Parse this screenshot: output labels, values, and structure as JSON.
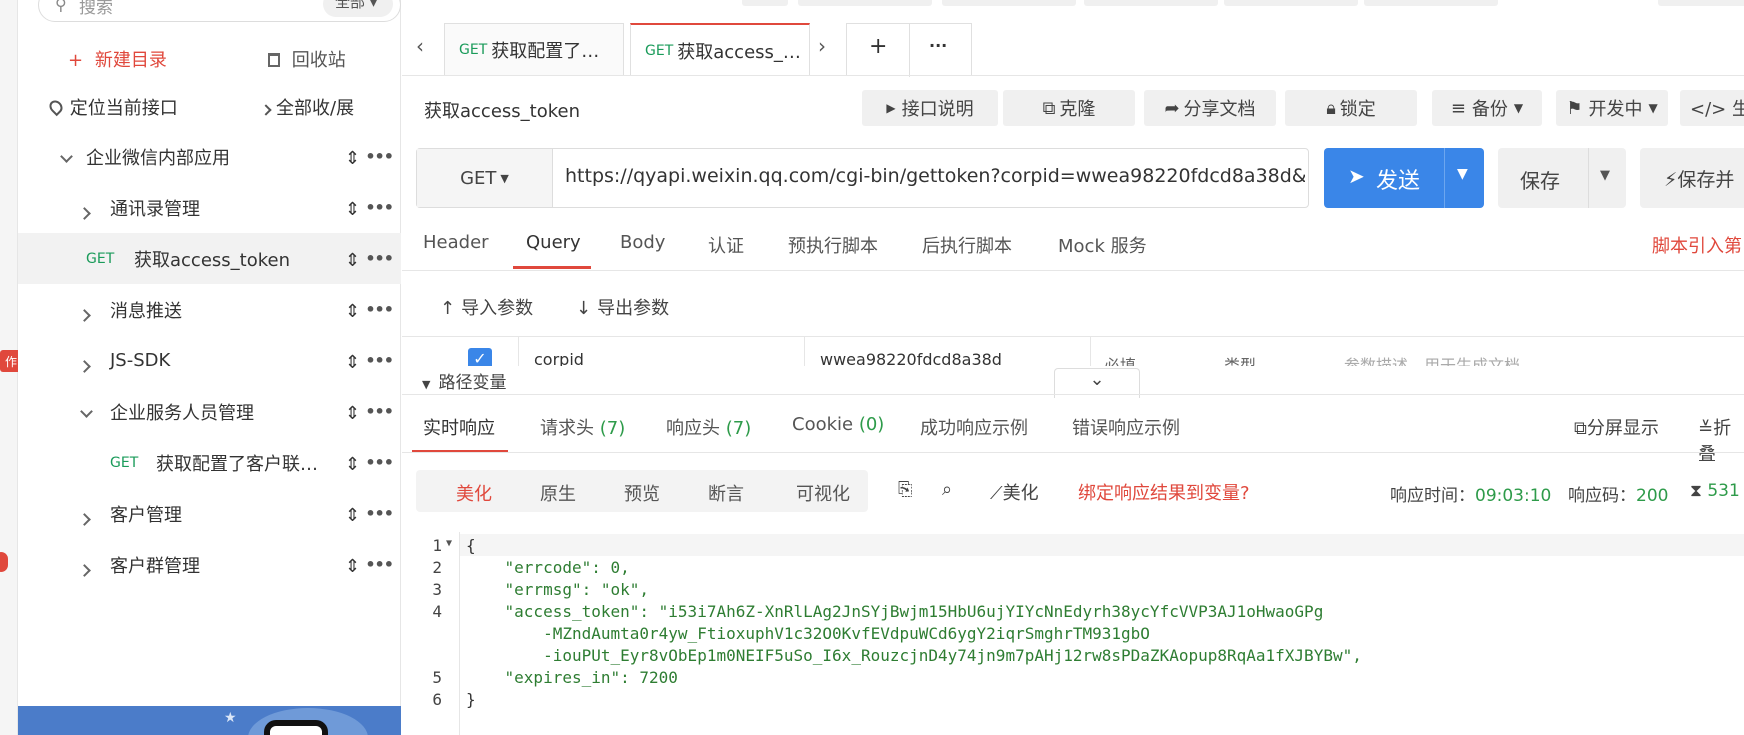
{
  "sidebar": {
    "search_placeholder": "搜索",
    "filter_label": "全部",
    "new_folder": "新建目录",
    "recycle": "回收站",
    "locate": "定位当前接口",
    "expand_all": "全部收/展",
    "tree": [
      {
        "label": "企业微信内部应用"
      },
      {
        "label": "通讯录管理"
      },
      {
        "method": "GET",
        "label": "获取access_token"
      },
      {
        "label": "消息推送"
      },
      {
        "label": "JS-SDK"
      },
      {
        "label": "企业服务人员管理"
      },
      {
        "method": "GET",
        "label": "获取配置了客户联…"
      },
      {
        "label": "客户管理"
      },
      {
        "label": "客户群管理"
      }
    ],
    "edge_badge": "作"
  },
  "tabs": [
    {
      "method": "GET",
      "label": "获取配置了…"
    },
    {
      "method": "GET",
      "label": "获取access_…"
    }
  ],
  "tabs_add": "+",
  "tabs_more": "···",
  "request": {
    "title": "获取access_token",
    "actions": [
      "接口说明",
      "克隆",
      "分享文档",
      "锁定",
      "备份",
      "开发中",
      "</> 生"
    ],
    "method": "GET",
    "url": "https://qyapi.weixin.qq.com/cgi-bin/gettoken?corpid=wwea98220fdcd8a38d&",
    "send": "发送",
    "save": "保存",
    "save_run": "保存并"
  },
  "param_tabs": [
    "Header",
    "Query",
    "Body",
    "认证",
    "预执行脚本",
    "后执行脚本",
    "Mock 服务"
  ],
  "param_tab_active": "Query",
  "script_link": "脚本引入第",
  "import_params": "导入参数",
  "export_params": "导出参数",
  "param_row": {
    "name": "corpid",
    "value": "wwea98220fdcd8a38d",
    "required": "必填",
    "type": "类型",
    "desc_placeholder": "参数描述，用于生成文档"
  },
  "path_vars": "路径变量",
  "response_tabs": [
    {
      "label": "实时响应"
    },
    {
      "label": "请求头",
      "count": "(7)"
    },
    {
      "label": "响应头",
      "count": "(7)"
    },
    {
      "label": "Cookie",
      "count": "(0)"
    },
    {
      "label": "成功响应示例"
    },
    {
      "label": "错误响应示例"
    }
  ],
  "split_view": "分屏显示",
  "collapse": "折叠",
  "view_modes": [
    "美化",
    "原生",
    "预览",
    "断言",
    "可视化"
  ],
  "beautify": "美化",
  "bind_link": "绑定响应结果到变量?",
  "meta": {
    "time_label": "响应时间：",
    "time": "09:03:10",
    "code_label": "响应码：",
    "code": "200",
    "size": "531"
  },
  "json_lines": [
    {
      "n": "1",
      "text": "{"
    },
    {
      "n": "2",
      "text": "    \"errcode\": 0,"
    },
    {
      "n": "3",
      "text": "    \"errmsg\": \"ok\","
    },
    {
      "n": "4",
      "text": "    \"access_token\": \"i53i7Ah6Z-XnRlLAg2JnSYjBwjm15HbU6ujYIYcNnEdyrh38ycYfcVVP3AJ1oHwaoGPg"
    },
    {
      "n": "",
      "text": "        -MZndAumta0r4yw_FtioxuphV1c32O0KvfEVdpuWCd6ygY2iqrSmghrTM931gbO"
    },
    {
      "n": "",
      "text": "        -iouPUt_Eyr8vObEp1m0NEIF5uSo_I6x_RouzcjnD4y74jn9m7pAHj12rw8sPDaZKAopup8RqAa1fXJBYBw\","
    },
    {
      "n": "5",
      "text": "    \"expires_in\": 7200"
    },
    {
      "n": "6",
      "text": "}"
    }
  ],
  "colors": {
    "accent": "#e0483c",
    "blue": "#3a86e8",
    "green": "#2e9b4a"
  }
}
